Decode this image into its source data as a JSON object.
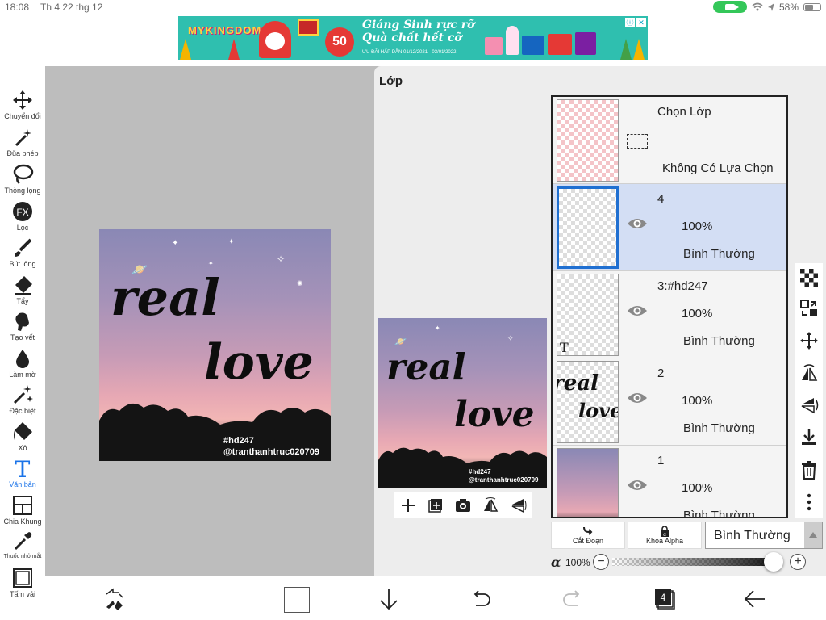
{
  "status_bar": {
    "time": "18:08",
    "date": "Th 4 22 thg 12",
    "battery": "58%",
    "battery_level": 0.58
  },
  "ad": {
    "brand": "MYKINGDOM",
    "badge": "50",
    "headline_line1": "Giáng Sinh rực rỡ",
    "headline_line2": "Quà chất hết cỡ",
    "subline": "ƯU ĐÃI HẤP DẪN  01/12/2021 - 03/01/2022",
    "info_icon": "info-icon",
    "close_icon": "close-icon"
  },
  "tools": [
    {
      "label": "Chuyển đổi",
      "icon": "move-icon"
    },
    {
      "label": "Đũa phép",
      "icon": "magic-wand-icon"
    },
    {
      "label": "Thòng lọng",
      "icon": "lasso-icon"
    },
    {
      "label": "Lọc",
      "icon": "fx-icon"
    },
    {
      "label": "Bút lông",
      "icon": "brush-icon"
    },
    {
      "label": "Tẩy",
      "icon": "eraser-icon"
    },
    {
      "label": "Tạo vết",
      "icon": "smudge-icon"
    },
    {
      "label": "Làm mờ",
      "icon": "blur-icon"
    },
    {
      "label": "Đặc biệt",
      "icon": "special-icon"
    },
    {
      "label": "Xô",
      "icon": "bucket-icon"
    },
    {
      "label": "Văn bản",
      "icon": "text-icon",
      "active": true
    },
    {
      "label": "Chia Khung",
      "icon": "frame-divider-icon"
    },
    {
      "label": "Thuốc nhỏ mắt",
      "icon": "eyedropper-icon"
    },
    {
      "label": "Tấm vải",
      "icon": "canvas-icon"
    }
  ],
  "artwork": {
    "line1": "real",
    "line2": "love",
    "credit1": "#hd247",
    "credit2": "@tranthanhtruc020709"
  },
  "layer_panel": {
    "title": "Lớp",
    "selection_layer": {
      "title": "Chọn Lớp",
      "status": "Không Có Lựa Chọn"
    },
    "layers": [
      {
        "name": "4",
        "opacity": "100%",
        "blend": "Bình Thường",
        "selected": true,
        "thumb": "empty"
      },
      {
        "name": "3:#hd247",
        "opacity": "100%",
        "blend": "Bình Thường",
        "selected": false,
        "thumb": "text",
        "thumb_mark": "T"
      },
      {
        "name": "2",
        "opacity": "100%",
        "blend": "Bình Thường",
        "selected": false,
        "thumb": "lettering",
        "thumb_line1": "real",
        "thumb_line2": "love"
      },
      {
        "name": "1",
        "opacity": "100%",
        "blend": "Bình Thường",
        "selected": false,
        "thumb": "photo"
      }
    ],
    "preview_tools": [
      "add-layer-icon",
      "add-layer-copy-icon",
      "camera-icon",
      "flip-horizontal-icon",
      "flip-vertical-icon"
    ],
    "right_tools": [
      "checkerboard-icon",
      "transfer-icon",
      "move-icon",
      "flip-horizontal-icon",
      "flip-vertical-icon",
      "merge-down-icon",
      "trash-icon",
      "more-icon"
    ],
    "clipping_label": "Cắt Đoạn",
    "alpha_lock_label": "Khóa Alpha",
    "blend_mode": "Bình Thường",
    "alpha_symbol": "α",
    "alpha_value": "100%",
    "alpha_fraction": 1.0
  },
  "bottom_bar": {
    "layer_count": "4",
    "icons": [
      "swap-tools-icon",
      "color-swatch",
      "down-arrow-icon",
      "undo-icon",
      "redo-icon",
      "layers-icon",
      "back-icon"
    ]
  }
}
